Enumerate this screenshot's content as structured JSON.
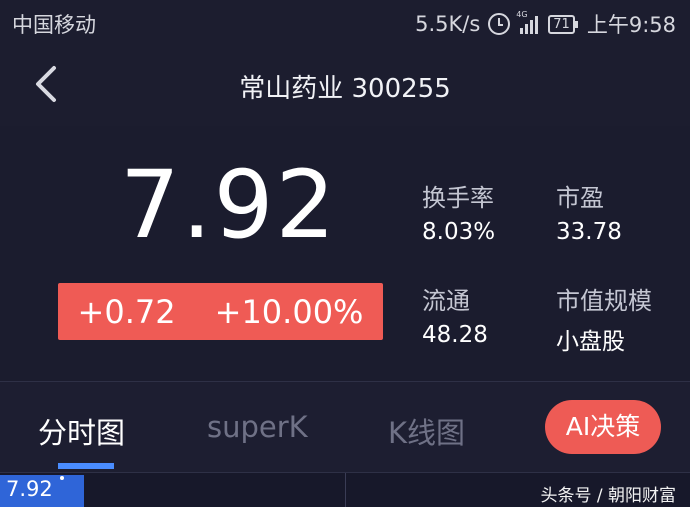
{
  "status_bar": {
    "carrier": "中国移动",
    "net_speed": "5.5K/s",
    "network_type": "4G",
    "battery": "71",
    "time": "上午9:58"
  },
  "header": {
    "title": "常山药业 300255",
    "back_icon": "chevron-left-icon"
  },
  "quote": {
    "price": "7.92",
    "change": "+0.72",
    "change_percent": "+10.00%",
    "accent_color": "#ef5b55",
    "metrics": [
      {
        "label": "换手率",
        "value": "8.03%"
      },
      {
        "label": "市盈",
        "value": "33.78"
      },
      {
        "label": "流通",
        "value": "48.28"
      },
      {
        "label": "市值规模",
        "value": "小盘股"
      }
    ]
  },
  "tabs": [
    {
      "label": "分时图",
      "active": true
    },
    {
      "label": "superK",
      "active": false
    },
    {
      "label": "K线图",
      "active": false
    }
  ],
  "ai_button": {
    "label": "AI决策"
  },
  "chart": {
    "price_label": "7.92"
  },
  "watermark": "头条号 / 朝阳财富"
}
